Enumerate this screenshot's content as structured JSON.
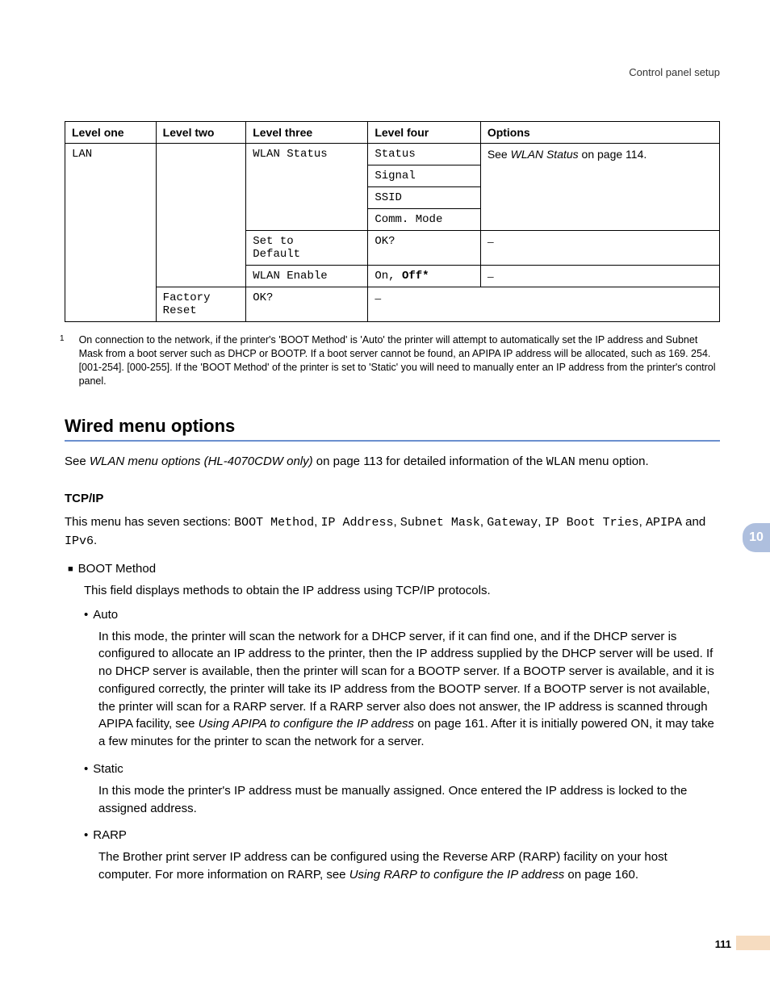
{
  "header": {
    "section": "Control panel setup"
  },
  "chapter_tab": "10",
  "page_number": "111",
  "table": {
    "headers": [
      "Level one",
      "Level two",
      "Level three",
      "Level four",
      "Options"
    ],
    "rows": {
      "r1": {
        "l1": "LAN",
        "l3": "WLAN Status",
        "l4": "Status",
        "opt_prefix": "See ",
        "opt_link": "WLAN Status",
        "opt_suffix": " on page 114."
      },
      "r2": {
        "l4": "Signal"
      },
      "r3": {
        "l4": "SSID"
      },
      "r4": {
        "l4": "Comm. Mode"
      },
      "r5": {
        "l3a": "Set to",
        "l3b": "Default",
        "l4": "OK?",
        "opt": "–"
      },
      "r6": {
        "l3": "WLAN Enable",
        "l4a": "On",
        "l4sep": ", ",
        "l4b": "Off*",
        "opt": "–"
      },
      "r7": {
        "l2a": "Factory",
        "l2b": "Reset",
        "l3": "OK?",
        "l4": "–"
      }
    }
  },
  "footnote": {
    "marker": "1",
    "text": "On connection to the network, if the printer's 'BOOT Method' is 'Auto' the printer will attempt to automatically set the IP address and Subnet Mask from a boot server such as DHCP or BOOTP. If a boot server cannot be found, an APIPA IP address will be allocated, such as 169. 254. [001-254]. [000-255]. If the 'BOOT Method' of the printer is set to 'Static' you will need to manually enter an IP address from the printer's control panel."
  },
  "section_title": "Wired menu options",
  "intro": {
    "prefix": "See ",
    "link": "WLAN menu options (HL-4070CDW only)",
    "mid": " on page 113 for detailed information of the ",
    "code": "WLAN",
    "suffix": " menu option."
  },
  "tcpip": {
    "heading": "TCP/IP",
    "lead_prefix": "This menu has seven sections: ",
    "items": [
      "BOOT Method",
      "IP Address",
      "Subnet Mask",
      "Gateway",
      "IP Boot Tries",
      "APIPA",
      "IPv6"
    ],
    "sep": ", ",
    "and": " and ",
    "period": "."
  },
  "boot": {
    "title": "BOOT Method",
    "desc": "This field displays methods to obtain the IP address using TCP/IP protocols.",
    "auto": {
      "label": "Auto",
      "body_a": "In this mode, the printer will scan the network for a DHCP server, if it can find one, and if the DHCP server is configured to allocate an IP address to the printer, then the IP address supplied by the DHCP server will be used. If no DHCP server is available, then the printer will scan for a BOOTP server. If a BOOTP server is available, and it is configured correctly, the printer will take its IP address from the BOOTP server. If a BOOTP server is not available, the printer will scan for a RARP server. If a RARP server also does not answer, the IP address is scanned through APIPA facility, see ",
      "link": "Using APIPA to configure the IP address",
      "body_b": " on page 161. After it is initially powered ON, it may take a few minutes for the printer to scan the network for a server."
    },
    "static": {
      "label": "Static",
      "body": "In this mode the printer's IP address must be manually assigned. Once entered the IP address is locked to the assigned address."
    },
    "rarp": {
      "label": "RARP",
      "body_a": "The Brother print server IP address can be configured using the Reverse ARP (RARP) facility on your host computer. For more information on RARP, see ",
      "link": "Using RARP to configure the IP address",
      "body_b": " on page 160."
    }
  }
}
